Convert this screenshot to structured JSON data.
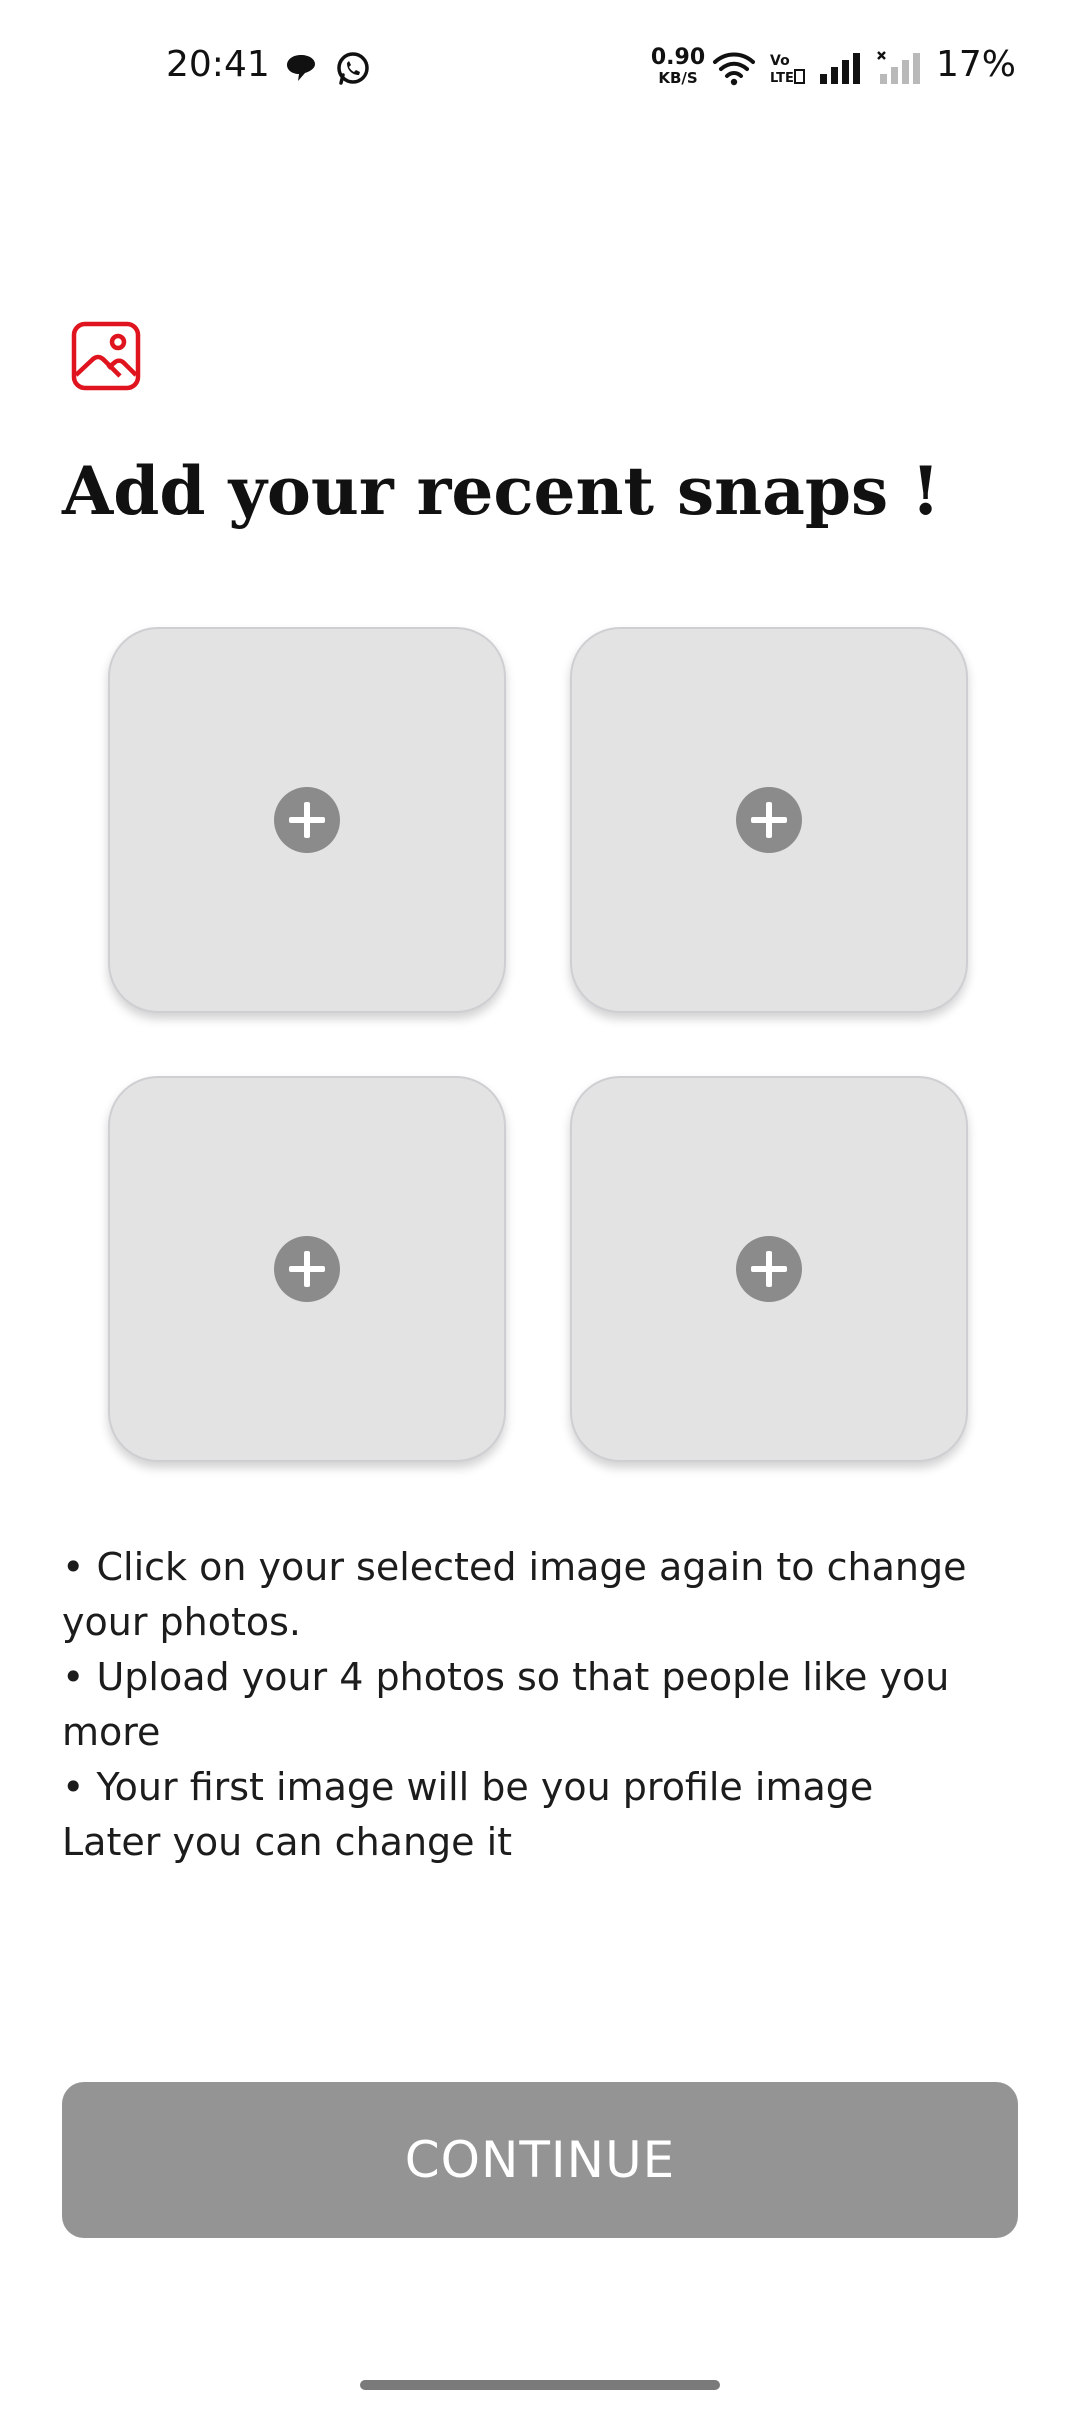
{
  "status_bar": {
    "time": "20:41",
    "notification_icons": [
      "chat-bubble-icon",
      "whatsapp-icon"
    ],
    "net_speed_value": "0.90",
    "net_speed_unit": "KB/S",
    "system_icons": [
      "wifi-icon",
      "volte-icon",
      "signal-icon",
      "signal-no-service-icon"
    ],
    "battery": "17%"
  },
  "header": {
    "icon": "image-icon",
    "icon_color": "#e0141e",
    "title": "Add your recent snaps !"
  },
  "photo_slots": [
    {
      "icon": "add-circle-icon"
    },
    {
      "icon": "add-circle-icon"
    },
    {
      "icon": "add-circle-icon"
    },
    {
      "icon": "add-circle-icon"
    }
  ],
  "notes": [
    "• Click on your selected image again to change your photos.",
    "• Upload your 4 photos so that people like you more",
    "• Your first image will be you profile image Later you can change it"
  ],
  "continue_button": {
    "label": "CONTINUE",
    "color": "#949494"
  }
}
